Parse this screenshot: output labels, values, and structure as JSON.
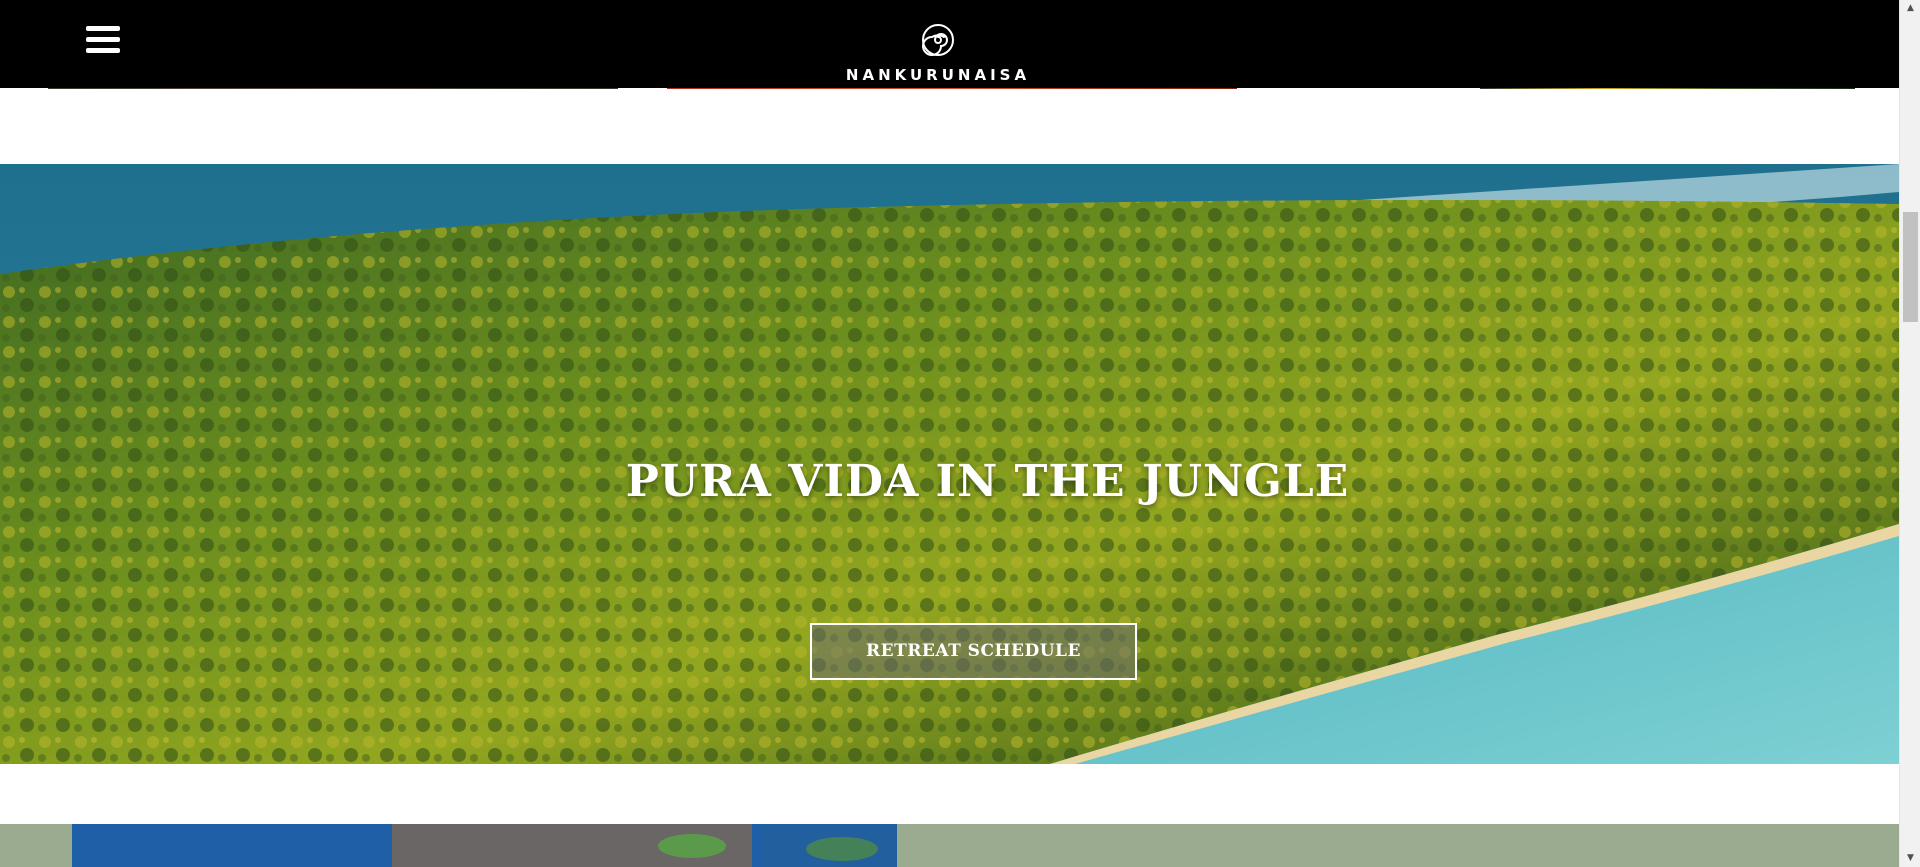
{
  "header": {
    "brand_name": "NANKURUNAISA",
    "logo_icon": "spiral-icon",
    "menu_icon": "hamburger-menu-icon",
    "background": "#000000"
  },
  "hero": {
    "title": "PURA VIDA IN THE JUNGLE",
    "cta_label": "RETREAT SCHEDULE"
  },
  "lower_section": {
    "band_color": "#9aab8f"
  }
}
